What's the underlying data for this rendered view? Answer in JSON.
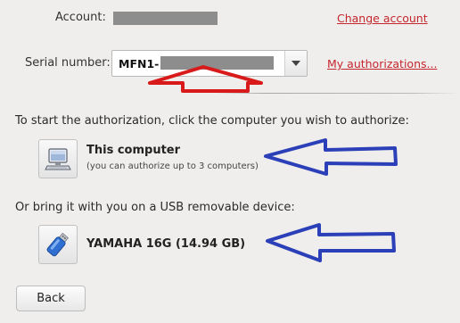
{
  "account": {
    "label": "Account:",
    "change_link": "Change account"
  },
  "serial": {
    "label": "Serial number:",
    "prefix": "MFN1-",
    "my_auth_link": "My authorizations..."
  },
  "computer_section": {
    "instruction": "To start the authorization, click the computer you wish to authorize:",
    "title": "This computer",
    "subtitle": "(you can authorize up to 3 computers)",
    "icon": "computer-icon"
  },
  "usb_section": {
    "instruction": "Or bring it with you on a USB removable device:",
    "device_name": "YAMAHA 16G  (14.94 GB)",
    "icon": "usb-drive-icon"
  },
  "buttons": {
    "back_label": "Back"
  },
  "colors": {
    "link": "#c4262e",
    "annotation_red": "#d81a1a",
    "annotation_blue": "#2b3fb8",
    "background": "#f0eeec"
  }
}
